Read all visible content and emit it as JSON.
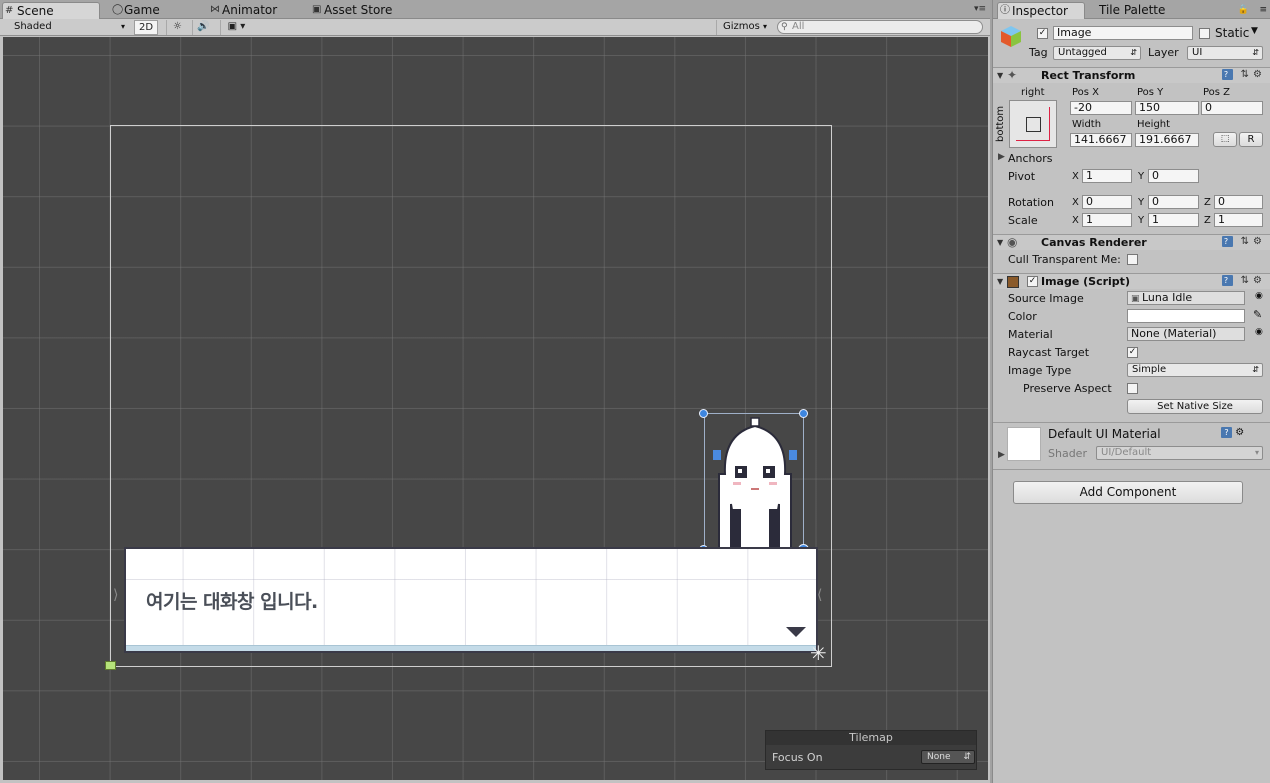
{
  "scene_tabs": {
    "scene": "Scene",
    "game": "Game",
    "animator": "Animator",
    "asset_store": "Asset Store"
  },
  "scene_toolbar": {
    "shading_mode": "Shaded",
    "mode_2d": "2D",
    "gizmos": "Gizmos",
    "search_placeholder": "All"
  },
  "dialog": {
    "text": "여기는 대화창 입니다."
  },
  "tilemap_overlay": {
    "title": "Tilemap",
    "focus_label": "Focus On",
    "focus_value": "None"
  },
  "inspector_tabs": {
    "inspector": "Inspector",
    "tile_palette": "Tile Palette"
  },
  "object": {
    "name": "Image",
    "static_label": "Static",
    "tag_label": "Tag",
    "tag_value": "Untagged",
    "layer_label": "Layer",
    "layer_value": "UI"
  },
  "rect_transform": {
    "title": "Rect Transform",
    "anchor_h": "right",
    "anchor_v": "bottom",
    "pos_x_label": "Pos X",
    "pos_y_label": "Pos Y",
    "pos_z_label": "Pos Z",
    "pos_x": "-20",
    "pos_y": "150",
    "pos_z": "0",
    "width_label": "Width",
    "height_label": "Height",
    "width": "141.6667",
    "height": "191.6667",
    "r_button": "R",
    "anchors_label": "Anchors",
    "pivot_label": "Pivot",
    "pivot_x": "1",
    "pivot_y": "0",
    "rotation_label": "Rotation",
    "rot_x": "0",
    "rot_y": "0",
    "rot_z": "0",
    "scale_label": "Scale",
    "scale_x": "1",
    "scale_y": "1",
    "scale_z": "1",
    "x": "X",
    "y": "Y",
    "z": "Z"
  },
  "canvas_renderer": {
    "title": "Canvas Renderer",
    "cull_label": "Cull Transparent Me:"
  },
  "image_script": {
    "title": "Image (Script)",
    "source_image_label": "Source Image",
    "source_image_value": "Luna Idle",
    "color_label": "Color",
    "color_value": "#ffffff",
    "material_label": "Material",
    "material_value": "None (Material)",
    "raycast_label": "Raycast Target",
    "image_type_label": "Image Type",
    "image_type_value": "Simple",
    "preserve_label": "Preserve Aspect",
    "set_native_size": "Set Native Size"
  },
  "material": {
    "name": "Default UI Material",
    "shader_label": "Shader",
    "shader_value": "UI/Default"
  },
  "add_component": "Add Component"
}
